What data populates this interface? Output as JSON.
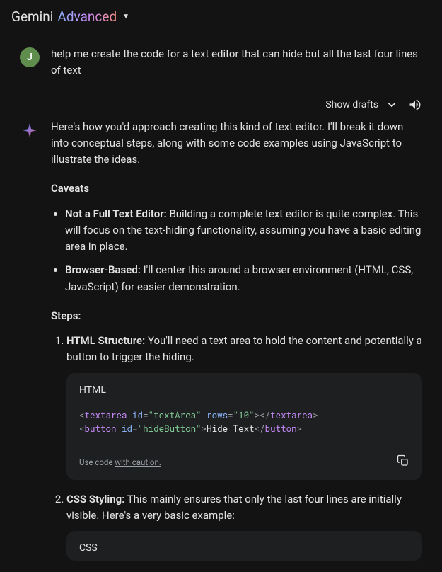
{
  "header": {
    "brand_primary": "Gemini",
    "brand_secondary": "Advanced"
  },
  "user": {
    "avatar_initial": "J",
    "prompt": "help me create the code for a text editor that can hide but all the last four lines of text"
  },
  "actions": {
    "show_drafts": "Show drafts"
  },
  "response": {
    "intro": "Here's how you'd approach creating this kind of text editor. I'll break it down into conceptual steps, along with some code examples using JavaScript to illustrate the ideas.",
    "caveats_heading": "Caveats",
    "caveats": [
      {
        "label": "Not a Full Text Editor:",
        "text": " Building a complete text editor is quite complex. This will focus on the text-hiding functionality, assuming you have a basic editing area in place."
      },
      {
        "label": "Browser-Based:",
        "text": " I'll center this around a browser environment (HTML, CSS, JavaScript) for easier demonstration."
      }
    ],
    "steps_heading": "Steps:",
    "steps": [
      {
        "label": "HTML Structure:",
        "text": " You'll need a text area to hold the content and potentially a button to trigger the hiding."
      },
      {
        "label": "CSS Styling:",
        "text": "  This mainly ensures that only the last four lines are initially visible. Here's a very basic example:"
      }
    ],
    "code_blocks": {
      "html": {
        "lang": "HTML",
        "caution_prefix": "Use code ",
        "caution_link": "with caution.",
        "tokens": {
          "lt1": "<",
          "tag_textarea1": "textarea",
          "sp1": " ",
          "attr_id1": "id",
          "eq1": "=",
          "str_textArea": "\"textArea\"",
          "sp2": " ",
          "attr_rows": "rows",
          "eq2": "=",
          "str_10": "\"10\"",
          "gt1": "></",
          "tag_textarea2": "textarea",
          "gt2": ">",
          "nl": "\n",
          "lt2": "<",
          "tag_button1": "button",
          "sp3": " ",
          "attr_id2": "id",
          "eq3": "=",
          "str_hideButton": "\"hideButton\"",
          "gt3": ">",
          "txt_hide": "Hide Text",
          "lt3": "</",
          "tag_button2": "button",
          "gt4": ">"
        }
      },
      "css": {
        "lang": "CSS"
      }
    }
  }
}
